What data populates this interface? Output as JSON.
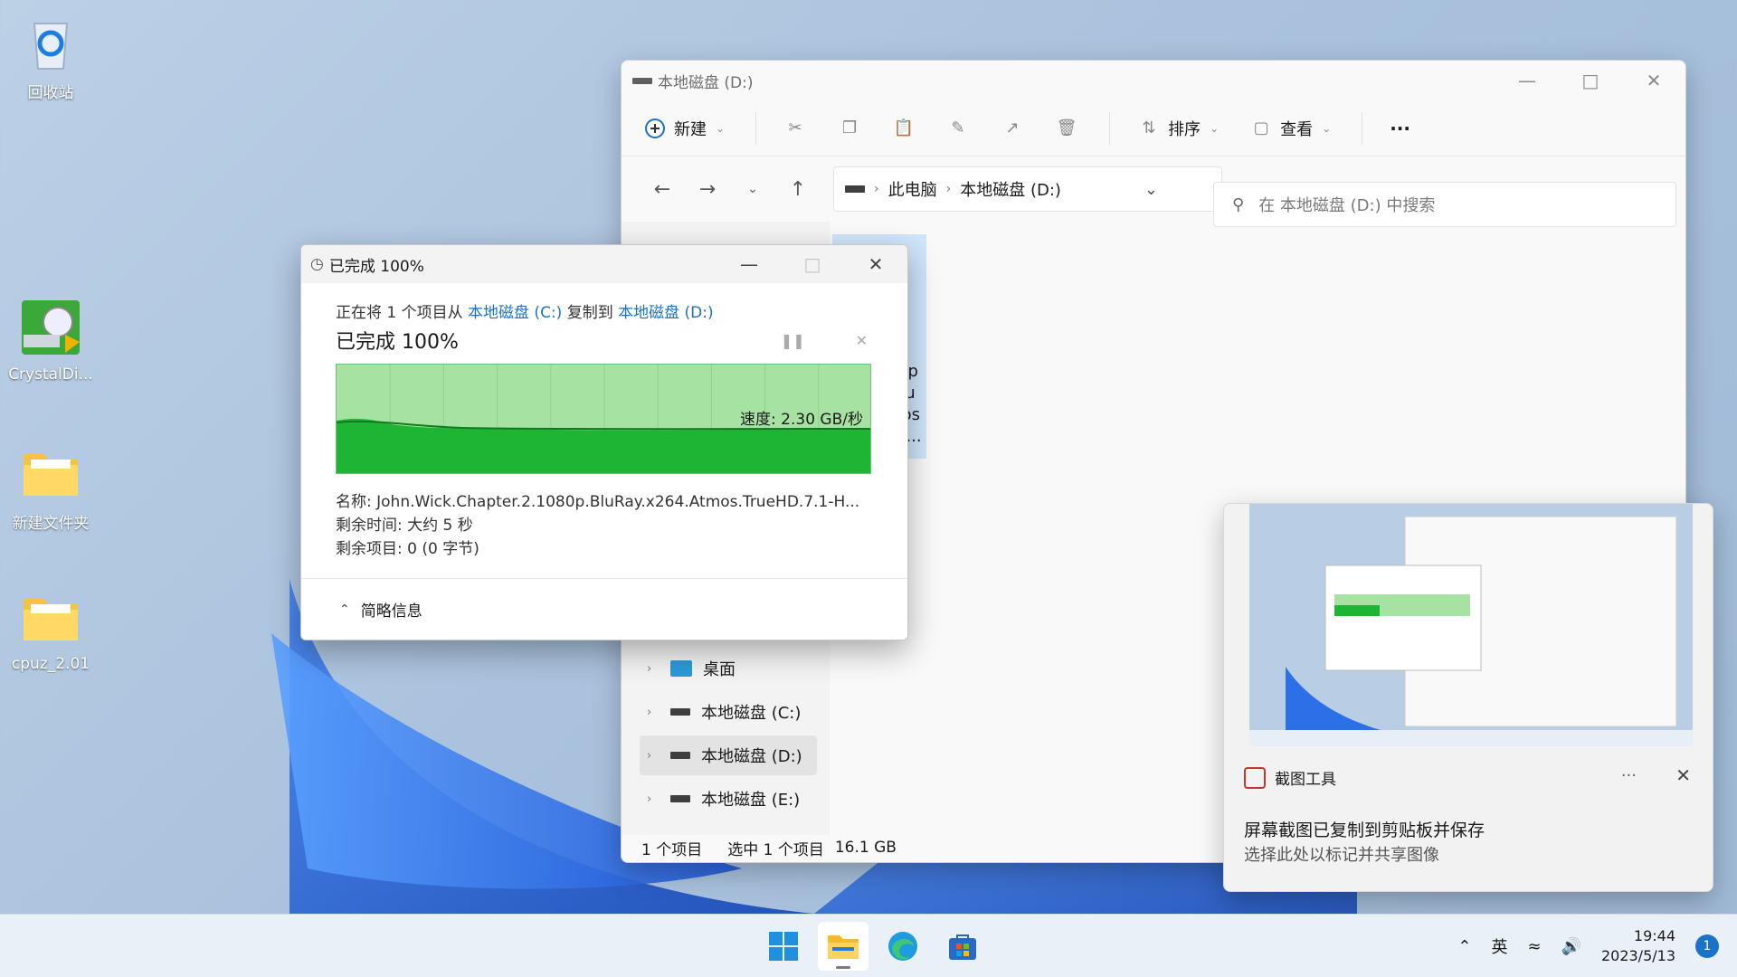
{
  "colors": {
    "accent": "#1a73c8",
    "progress_light": "#a6e2a1",
    "progress_dark": "#1fb534",
    "selection": "#cfe5fb"
  },
  "desktop": {
    "icons": [
      {
        "label": "回收站",
        "icon": "recycle-bin-icon"
      },
      {
        "label": "CrystalDi...",
        "icon": "crystaldisk-icon"
      },
      {
        "label": "新建文件夹",
        "icon": "folder-icon"
      },
      {
        "label": "cpuz_2.01",
        "icon": "folder-icon"
      }
    ]
  },
  "explorer": {
    "title": "本地磁盘 (D:)",
    "toolbar": {
      "new_label": "新建",
      "sort_label": "排序",
      "view_label": "查看",
      "more_label": "···"
    },
    "address": {
      "crumb_pc": "此电脑",
      "crumb_drive": "本地磁盘 (D:)"
    },
    "search_placeholder": "在 本地磁盘 (D:) 中搜索",
    "nav": [
      {
        "label": "桌面",
        "icon": "desktop-icon"
      },
      {
        "label": "本地磁盘 (C:)",
        "icon": "drive-c-icon"
      },
      {
        "label": "本地磁盘 (D:)",
        "icon": "drive-icon",
        "selected": true
      },
      {
        "label": "本地磁盘 (E:)",
        "icon": "drive-icon"
      }
    ],
    "file_name": "Wick.Chap\n1080p.Blu\n264.Atmos\nHD.7.1-H...",
    "status": {
      "count": "1 个项目",
      "selected": "选中 1 个项目",
      "size": "16.1 GB"
    }
  },
  "dialog": {
    "title": "已完成 100%",
    "copy_prefix": "正在将 1 个项目从 ",
    "source": "本地磁盘 (C:)",
    "copy_mid": " 复制到 ",
    "dest": "本地磁盘 (D:)",
    "status": "已完成 100%",
    "speed": "速度: 2.30 GB/秒",
    "name_label": "名称:",
    "name_value": "John.Wick.Chapter.2.1080p.BluRay.x264.Atmos.TrueHD.7.1-H...",
    "time_label": "剩余时间:",
    "time_value": "大约 5 秒",
    "items_label": "剩余项目:",
    "items_value": "0 (0 字节)",
    "less_details": "简略信息",
    "progress": 1.0
  },
  "toast": {
    "app": "截图工具",
    "more": "···",
    "line1": "屏幕截图已复制到剪贴板并保存",
    "line2": "选择此处以标记并共享图像"
  },
  "taskbar": {
    "lang": "英",
    "time": "19:44",
    "date": "2023/5/13",
    "badge": "1"
  }
}
